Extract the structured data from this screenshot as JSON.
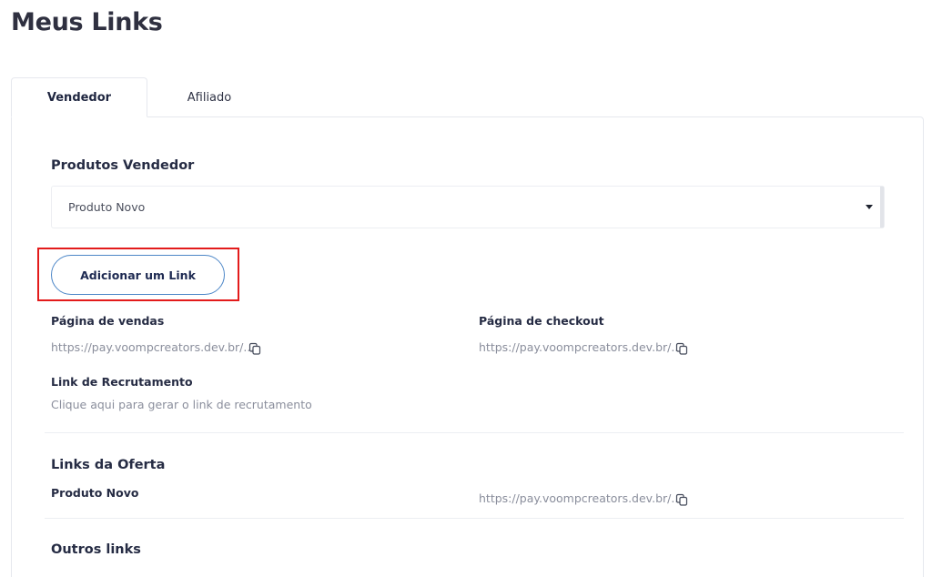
{
  "page": {
    "title": "Meus Links"
  },
  "tabs": [
    {
      "label": "Vendedor",
      "active": true
    },
    {
      "label": "Afiliado",
      "active": false
    }
  ],
  "seller": {
    "section_title": "Produtos Vendedor",
    "product_select": {
      "value": "Produto Novo"
    },
    "add_link_label": "Adicionar um Link",
    "sales_page": {
      "label": "Página de vendas",
      "url": "https://pay.voompcreators.dev.br/..."
    },
    "checkout_page": {
      "label": "Página de checkout",
      "url": "https://pay.voompcreators.dev.br/..."
    },
    "recruitment": {
      "label": "Link de Recrutamento",
      "text": "Clique aqui para gerar o link de recrutamento"
    }
  },
  "offer_links": {
    "section_title": "Links da Oferta",
    "product_name": "Produto Novo",
    "url": "https://pay.voompcreators.dev.br/..."
  },
  "other_links": {
    "section_title": "Outros links"
  },
  "colors": {
    "button_border": "#4c86c7",
    "highlight": "#e31b1b",
    "text_dark": "#262c44",
    "text_muted": "#8a8e9c"
  },
  "icons": {
    "copy": "copy-icon",
    "dropdown": "caret-down-icon"
  }
}
